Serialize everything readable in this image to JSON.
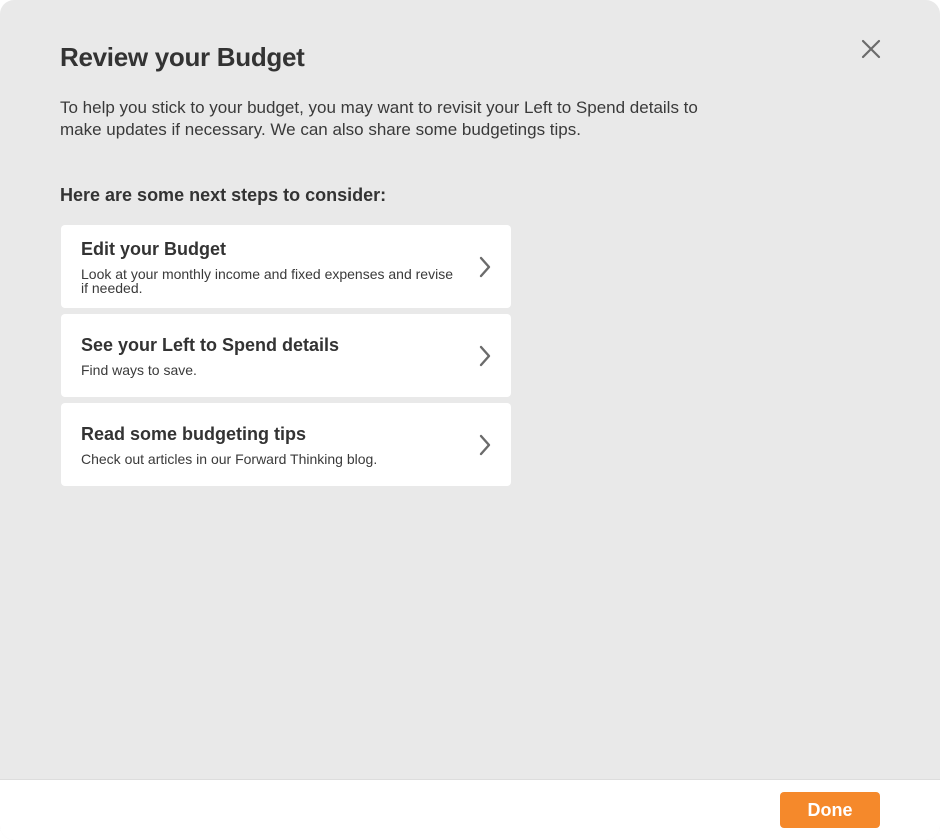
{
  "dialog": {
    "title": "Review your Budget",
    "intro": "To help you stick to your budget, you may want to revisit your Left to Spend details to make updates if necessary. We can also share some budgetings tips.",
    "steps_heading": "Here are some next steps to consider:",
    "close_icon": "close-icon",
    "steps": [
      {
        "title": "Edit your Budget",
        "description": "Look at your monthly income and fixed expenses and revise if needed.",
        "icon": "chevron-right-icon"
      },
      {
        "title": "See your Left to Spend details",
        "description": "Find ways to save.",
        "icon": "chevron-right-icon"
      },
      {
        "title": "Read some budgeting tips",
        "description": "Check out articles in our Forward Thinking blog.",
        "icon": "chevron-right-icon"
      }
    ]
  },
  "footer": {
    "done_label": "Done"
  },
  "colors": {
    "dialog_background": "#e9e9e9",
    "card_background": "#ffffff",
    "accent": "#f5892b",
    "text": "#333333",
    "icon": "#6b6b6b"
  }
}
